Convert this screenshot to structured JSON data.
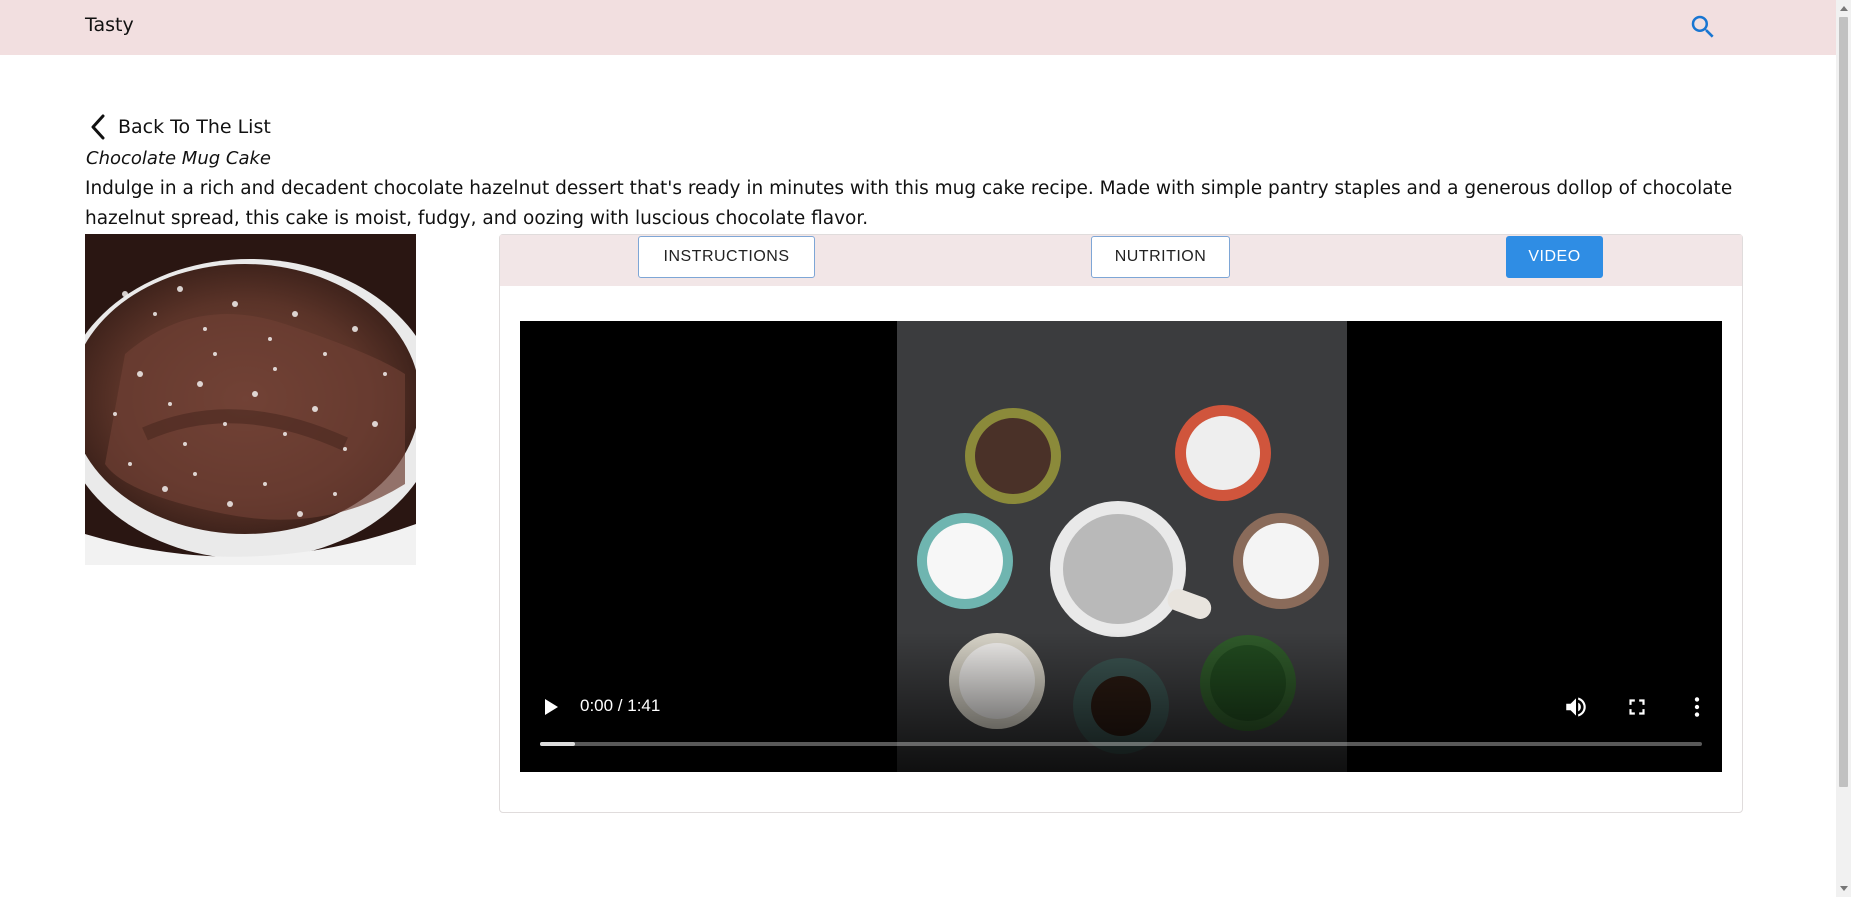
{
  "navbar": {
    "brand": "Tasty",
    "search_icon": "search-icon"
  },
  "back_link": {
    "label": "Back To The List",
    "icon": "chevron-left-icon"
  },
  "recipe": {
    "title": "Chocolate Mug Cake",
    "description": "Indulge in a rich and decadent chocolate hazelnut dessert that's ready in minutes with this mug cake recipe. Made with simple pantry staples and a generous dollop of chocolate hazelnut spread, this cake is moist, fudgy, and oozing with luscious chocolate flavor."
  },
  "tabs": [
    {
      "label": "INSTRUCTIONS",
      "active": false
    },
    {
      "label": "NUTRITION",
      "active": false
    },
    {
      "label": "VIDEO",
      "active": true
    }
  ],
  "video": {
    "time": "0:00 / 1:41",
    "progress": 0.03,
    "controls": [
      "play-icon",
      "volume-icon",
      "fullscreen-icon",
      "more-options-icon"
    ]
  },
  "colors": {
    "navbar_bg": "#f2dfe0",
    "tabbar_bg": "#f2e6e7",
    "active_tab": "#2f8de4",
    "search_icon": "#1976d2"
  }
}
